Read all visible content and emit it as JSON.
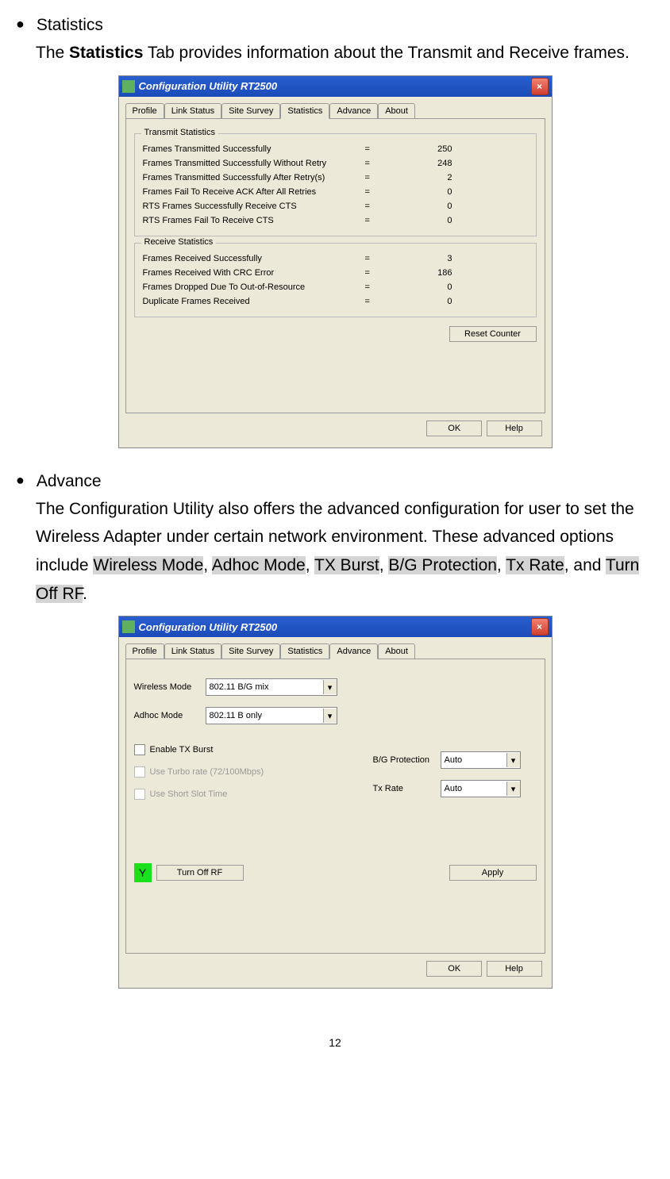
{
  "section1": {
    "bullet": "●",
    "title": "Statistics",
    "body_pre": "The ",
    "body_bold": "Statistics",
    "body_post": " Tab provides information about the Transmit and Receive frames."
  },
  "section2": {
    "bullet": "●",
    "title": "Advance",
    "body_pre": "The Configuration Utility also offers the advanced configuration for user to set the Wireless Adapter under certain network environment. These advanced options include ",
    "h1": "Wireless Mode",
    "c1": ", ",
    "h2": "Adhoc Mode",
    "c2": ", ",
    "h3": "TX Burst",
    "c3": ", ",
    "h4": "B/G Protection",
    "c4": ", ",
    "h5": "Tx Rate",
    "c5": ", and ",
    "h6": "Turn Off RF",
    "c6": "."
  },
  "window": {
    "title": "Configuration Utility RT2500",
    "tabs": {
      "profile": "Profile",
      "link_status": "Link Status",
      "site_survey": "Site Survey",
      "statistics": "Statistics",
      "advance": "Advance",
      "about": "About"
    },
    "buttons": {
      "reset_counter": "Reset Counter",
      "ok": "OK",
      "help": "Help",
      "apply": "Apply",
      "turn_off_rf": "Turn Off RF"
    }
  },
  "stats": {
    "transmit": {
      "title": "Transmit Statistics",
      "rows": [
        {
          "label": "Frames Transmitted Successfully",
          "eq": "=",
          "val": "250"
        },
        {
          "label": "Frames Transmitted Successfully  Without Retry",
          "eq": "=",
          "val": "248"
        },
        {
          "label": "Frames Transmitted Successfully After Retry(s)",
          "eq": "=",
          "val": "2"
        },
        {
          "label": "Frames Fail To Receive ACK After All Retries",
          "eq": "=",
          "val": "0"
        },
        {
          "label": "RTS Frames Successfully Receive CTS",
          "eq": "=",
          "val": "0"
        },
        {
          "label": "RTS Frames Fail To Receive CTS",
          "eq": "=",
          "val": "0"
        }
      ]
    },
    "receive": {
      "title": "Receive Statistics",
      "rows": [
        {
          "label": "Frames Received Successfully",
          "eq": "=",
          "val": "3"
        },
        {
          "label": "Frames Received With CRC Error",
          "eq": "=",
          "val": "186"
        },
        {
          "label": "Frames Dropped Due To Out-of-Resource",
          "eq": "=",
          "val": "0"
        },
        {
          "label": "Duplicate Frames Received",
          "eq": "=",
          "val": "0"
        }
      ]
    }
  },
  "advance": {
    "wireless_mode": {
      "label": "Wireless Mode",
      "value": "802.11 B/G mix"
    },
    "adhoc_mode": {
      "label": "Adhoc Mode",
      "value": "802.11 B only"
    },
    "enable_tx_burst": "Enable TX Burst",
    "use_turbo": "Use Turbo rate (72/100Mbps)",
    "use_short_slot": "Use Short Slot Time",
    "bg_protection": {
      "label": "B/G Protection",
      "value": "Auto"
    },
    "tx_rate": {
      "label": "Tx Rate",
      "value": "Auto"
    },
    "rf_icon": "Y"
  },
  "page_number": "12"
}
